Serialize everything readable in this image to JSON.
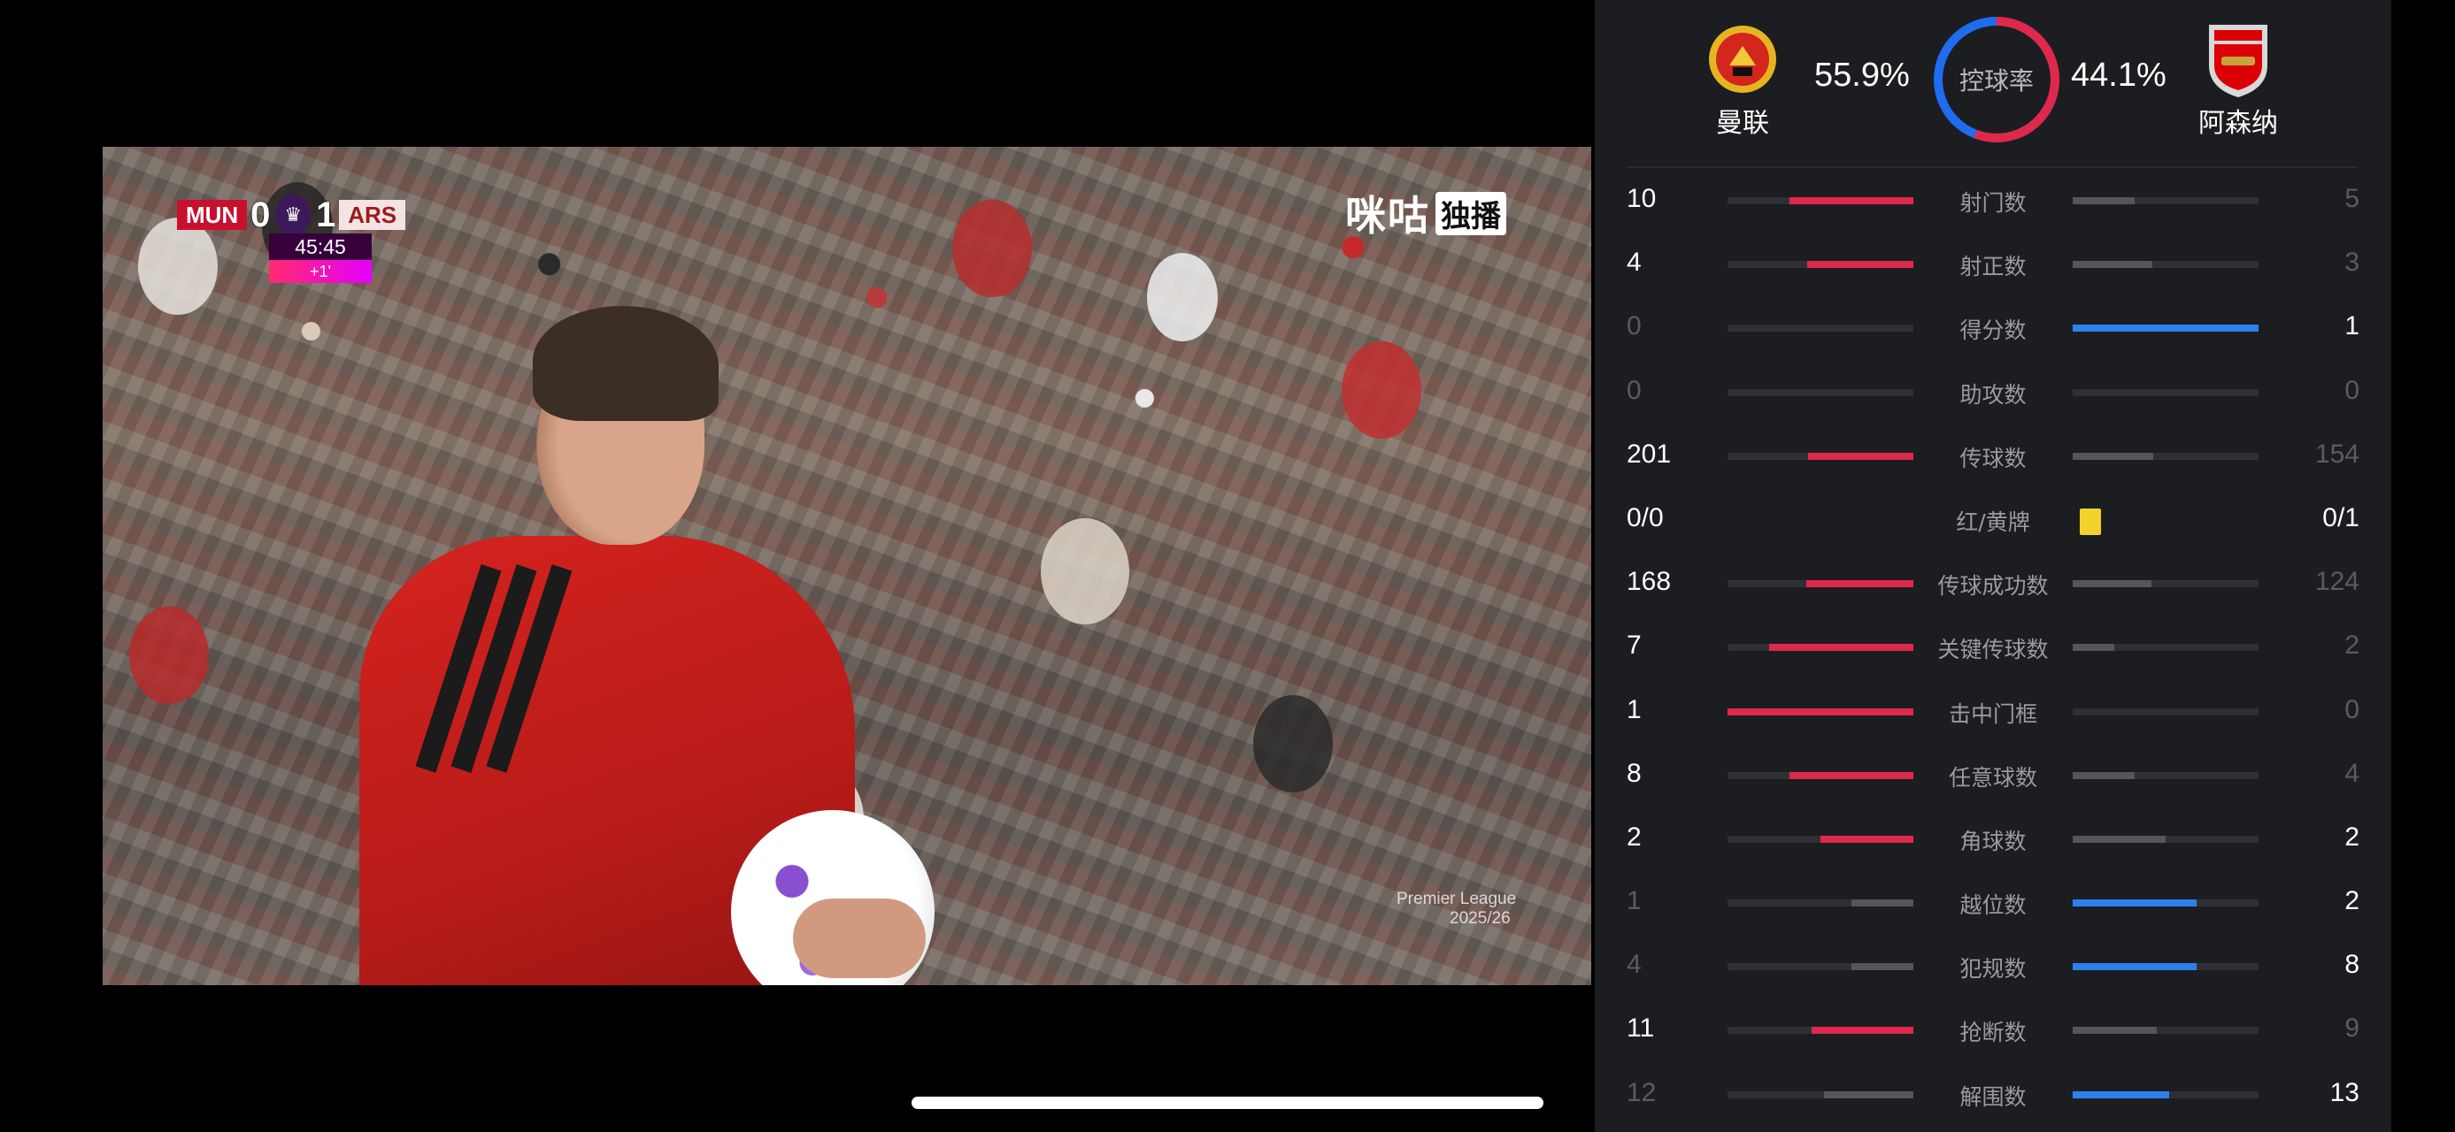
{
  "video": {
    "scorebug": {
      "home_code": "MUN",
      "home_score": "0",
      "away_score": "1",
      "away_code": "ARS",
      "clock": "45:45",
      "added_time": "+1'"
    },
    "watermark_text": "咪咕",
    "watermark_tag": "独播",
    "corner_text_1": "Premier League",
    "corner_text_2": "2025/26"
  },
  "header": {
    "home_name": "曼联",
    "away_name": "阿森纳",
    "possession_home": "55.9%",
    "possession_away": "44.1%",
    "possession_label": "控球率",
    "possession_home_fraction": 0.559,
    "home_color": "#e0284a",
    "away_color": "#1e6cf0"
  },
  "colors": {
    "home_bar": "#e0284a",
    "away_bar": "#2a82ef",
    "muted_bar": "#55565c",
    "yellow_card": "#f4d22c"
  },
  "stats": [
    {
      "label": "射门数",
      "home": "10",
      "away": "5",
      "hv": 10,
      "av": 5
    },
    {
      "label": "射正数",
      "home": "4",
      "away": "3",
      "hv": 4,
      "av": 3
    },
    {
      "label": "得分数",
      "home": "0",
      "away": "1",
      "hv": 0,
      "av": 1
    },
    {
      "label": "助攻数",
      "home": "0",
      "away": "0",
      "hv": 0,
      "av": 0
    },
    {
      "label": "传球数",
      "home": "201",
      "away": "154",
      "hv": 201,
      "av": 154
    },
    {
      "label": "红/黄牌",
      "home": "0/0",
      "away": "0/1",
      "hv": 0,
      "av": 1,
      "card": true
    },
    {
      "label": "传球成功数",
      "home": "168",
      "away": "124",
      "hv": 168,
      "av": 124
    },
    {
      "label": "关键传球数",
      "home": "7",
      "away": "2",
      "hv": 7,
      "av": 2
    },
    {
      "label": "击中门框",
      "home": "1",
      "away": "0",
      "hv": 1,
      "av": 0
    },
    {
      "label": "任意球数",
      "home": "8",
      "away": "4",
      "hv": 8,
      "av": 4
    },
    {
      "label": "角球数",
      "home": "2",
      "away": "2",
      "hv": 2,
      "av": 2
    },
    {
      "label": "越位数",
      "home": "1",
      "away": "2",
      "hv": 1,
      "av": 2
    },
    {
      "label": "犯规数",
      "home": "4",
      "away": "8",
      "hv": 4,
      "av": 8
    },
    {
      "label": "抢断数",
      "home": "11",
      "away": "9",
      "hv": 11,
      "av": 9
    },
    {
      "label": "解围数",
      "home": "12",
      "away": "13",
      "hv": 12,
      "av": 13
    }
  ]
}
